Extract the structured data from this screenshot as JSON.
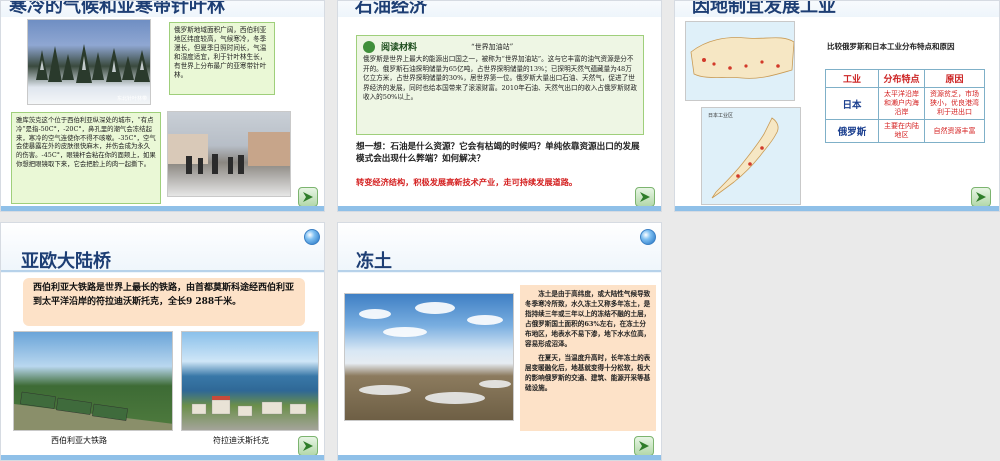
{
  "slides": [
    {
      "title": "寒冷的气候和亚寒带针叶林",
      "text_top": "俄罗斯地域面积广阔，西伯利亚地区纬度较高，气候寒冷，冬季漫长，但夏季日照时间长，气温和湿度适宜，利于针叶林生长，有世界上分布最广的亚寒带针叶林。",
      "text_bottom": "雅库茨克这个位于西伯利亚纵深处的城市，“有点冷”是指-50C°，-20C°，鼻孔里的潮气会冻结起来，寒冷的空气连使你不得不咳嗽。-35C°，空气会使暴露在外的皮肤很快麻木，并伤会成为永久的伤害。-45C°，眼镜杆会粘在你的面颊上，如果你想把眼镜取下来，它会把脸上的肉一起撕下。",
      "watermark": "东北针叶林带"
    },
    {
      "title": "石油经济",
      "reading_label": "阅读材料",
      "reading_subtitle": "“世界加油站”",
      "reading_text": "俄罗斯是世界上最大的能源出口国之一，被称为“世界加油站”。这与它丰富的油气资源是分不开的。俄罗斯石油探明储量为65亿吨，占世界探明储量的13%；已探明天然气蕴藏量为48万亿立方米，占世界探明储量的30%，居世界第一位。俄罗斯大量出口石油、天然气，促进了世界经济的发展，同时也给本国带来了滚滚财富。2010年石油、天然气出口的收入占俄罗斯财政收入的50%以上。",
      "question": "想一想：石油是什么资源？它会有枯竭的时候吗？单纯依靠资源出口的发展模式会出现什么弊端？如何解决？",
      "answer": "转变经济结构，积极发展高新技术产业，走可持续发展道路。"
    },
    {
      "title": "因地制宜发展工业",
      "prompt": "比较俄罗斯和日本工业分布特点和原因",
      "table_headers": [
        "工业",
        "分布特点",
        "原因"
      ],
      "rows": [
        {
          "country": "日本",
          "feature": "太平洋沿岸和濑户内海沿岸",
          "reason": "资源贫乏，市场狭小，优良港湾利于进出口"
        },
        {
          "country": "俄罗斯",
          "feature": "主要在内陆地区",
          "reason": "自然资源丰富"
        }
      ],
      "map_label": "日本工业区"
    },
    {
      "title": "亚欧大陆桥",
      "text": "西伯利亚大铁路是世界上最长的铁路，由首都莫斯科途经西伯利亚到太平洋沿岸的符拉迪沃斯托克，全长9 288千米。",
      "caption_left": "西伯利亚大铁路",
      "caption_right": "符拉迪沃斯托克"
    },
    {
      "title": "冻土",
      "text1": "冻土是由于高纬度，或大陆性气候导致冬季寒冷所致，水久冻土又称多年冻土，是指持续三年或三年以上的冻结不融的土层，占俄罗斯国土面积的63%左右，在冻土分布地区，地表水不易下渗，地下水水位高，容易形成沼泽。",
      "text2": "在夏天，当温度升高时，长年冻土的表层变暖融化后，地基就变得十分松软，极大的影响俄罗斯的交通、建筑、能源开采等基础设施。"
    }
  ],
  "colors": {
    "title": "#1d3e74",
    "accent_red": "#d42020",
    "green_box": "#eaf8d6",
    "peach_box": "#fde2c8"
  }
}
